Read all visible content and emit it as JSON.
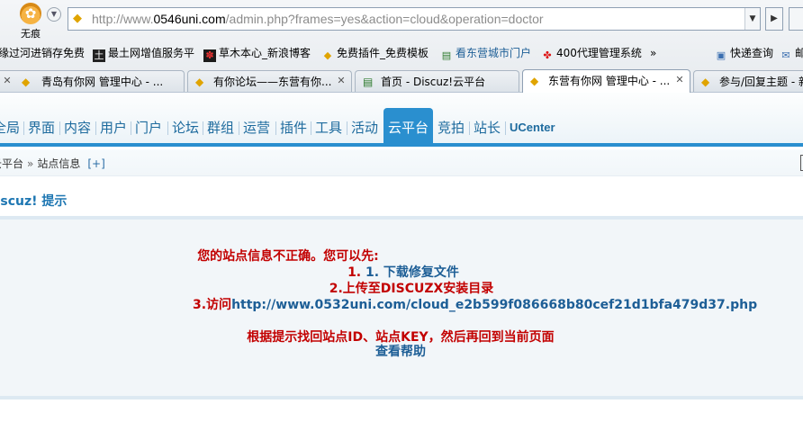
{
  "browser": {
    "logo_label": "无痕",
    "address": {
      "prefix": "http://www.",
      "domain": "0546uni.com",
      "path": "/admin.php?frames=yes&action=cloud&operation=doctor"
    },
    "bookmarks": [
      {
        "label": "缘过河进销存免费",
        "icon": "none"
      },
      {
        "label": "最土网增值服务平",
        "icon": "box-icon"
      },
      {
        "label": "草木本心_新浪博客",
        "icon": "plant-icon"
      },
      {
        "label": "免费插件_免费模板",
        "icon": "discuz-icon"
      },
      {
        "label": "看东营城市门户",
        "icon": "page-icon"
      },
      {
        "label": "400代理管理系统",
        "icon": "unicom-icon"
      },
      {
        "label": "快递查询",
        "icon": "image-icon"
      },
      {
        "label": "邮",
        "icon": "mail-icon"
      }
    ],
    "bookmarks_more": "»",
    "tabs": [
      {
        "label": "青岛有你网 管理中心 - ..."
      },
      {
        "label": "有你论坛——东营有你..."
      },
      {
        "label": "首页 - Discuz!云平台"
      },
      {
        "label": "东营有你网 管理中心 - ..."
      },
      {
        "label": "参与/回复主题 - 新"
      }
    ],
    "active_tab": 3
  },
  "nav": {
    "items": [
      "全局",
      "界面",
      "内容",
      "用户",
      "门户",
      "论坛",
      "群组",
      "运营",
      "插件",
      "工具",
      "活动",
      "云平台",
      "竞拍",
      "站长",
      "UCenter"
    ],
    "active_index": 11
  },
  "breadcrumb": {
    "first": "云平台",
    "separator": "»",
    "current": "站点信息",
    "add": "[+]"
  },
  "section_title": "Discuz! 提示",
  "message": {
    "line1": "您的站点信息不正确。您可以先:",
    "line2": "1. 下载修复文件",
    "line3": "2.上传至DISCUZX安装目录",
    "line4_prefix": "3.访问",
    "line4_url": "http://www.0532uni.com/cloud_e2b599f086668b80cef21d1bfa479d37.php",
    "line5": "根据提示找回站点ID、站点KEY，然后再回到当前页面",
    "help_link": "查看帮助"
  },
  "colors": {
    "accent": "#2a8fcf",
    "nav_text": "#1e6b9e",
    "error_red": "#c20000",
    "link_blue": "#1d5e96"
  }
}
